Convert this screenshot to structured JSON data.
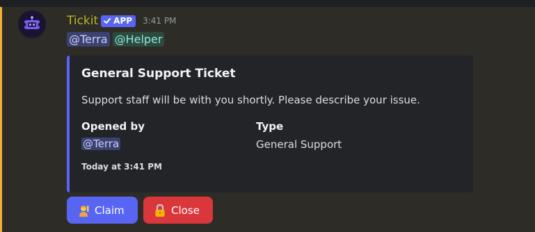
{
  "message": {
    "author": "Tickit",
    "app_tag": "APP",
    "timestamp": "3:41 PM",
    "mentions": [
      {
        "text": "@Terra",
        "kind": "user"
      },
      {
        "text": "@Helper",
        "kind": "role"
      }
    ]
  },
  "embed": {
    "accent_color": "#5865f2",
    "title": "General Support Ticket",
    "description": "Support staff will be with you shortly. Please describe your issue.",
    "fields": [
      {
        "name": "Opened by",
        "value": "@Terra"
      },
      {
        "name": "Type",
        "value": "General Support"
      }
    ],
    "footer": "Today at 3:41 PM"
  },
  "buttons": {
    "claim": {
      "label": "Claim",
      "icon": "person-raising-hand-icon",
      "color": "#5865f2"
    },
    "close": {
      "label": "Close",
      "icon": "lock-icon",
      "color": "#da373c"
    }
  },
  "colors": {
    "mention_highlight": "#f0b232",
    "username": "#b5b82a"
  }
}
